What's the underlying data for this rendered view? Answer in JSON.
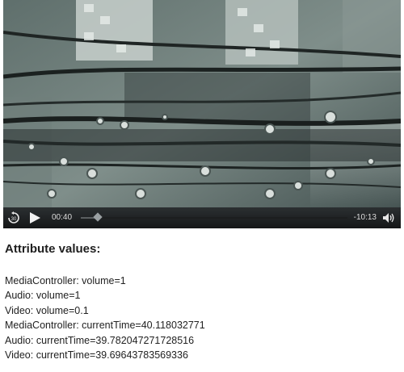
{
  "player": {
    "elapsed": "00:40",
    "remaining": "-10:13",
    "skip_back_label": "30",
    "progress_fraction": 0.063,
    "icons": {
      "skip_back": "rewind-30-icon",
      "play": "play-icon",
      "volume": "speaker-icon"
    }
  },
  "attributes": {
    "heading": "Attribute values:",
    "lines": [
      "MediaController: volume=1",
      "Audio: volume=1",
      "Video: volume=0.1",
      "MediaController: currentTime=40.118032771",
      "Audio: currentTime=39.782047271728516",
      "Video: currentTime=39.69643783569336"
    ]
  }
}
